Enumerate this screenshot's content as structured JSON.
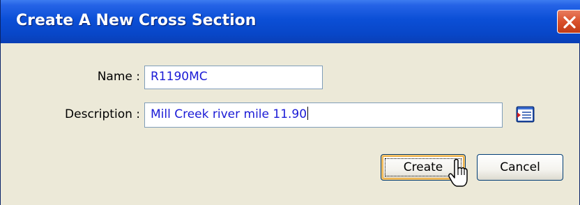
{
  "dialog": {
    "title": "Create A New Cross Section"
  },
  "form": {
    "name_label": "Name :",
    "name_value": "R1190MC",
    "description_label": "Description :",
    "description_value": "Mill Creek river mile 11.90"
  },
  "buttons": {
    "create_label": "Create",
    "cancel_label": "Cancel"
  },
  "icons": {
    "close": "close-icon",
    "browse": "browse-list-icon",
    "cursor": "mouse-pointer-icon"
  },
  "colors": {
    "titlebar": "#0b4fd6",
    "dialog_bg": "#ece9d8",
    "field_text": "#1a1ad6",
    "close_button": "#d9512c"
  }
}
